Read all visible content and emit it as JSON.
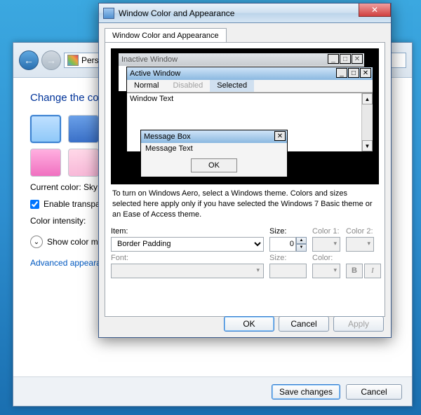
{
  "bg": {
    "addr_text": "Pers",
    "heading": "Change the color",
    "current_color_label": "Current color:",
    "current_color_value": "Sky",
    "transparency_label": "Enable transparenc",
    "intensity_label": "Color intensity:",
    "mixer_label": "Show color mixer",
    "adv_link": "Advanced appearance",
    "save": "Save changes",
    "cancel": "Cancel"
  },
  "dlg": {
    "title": "Window Color and Appearance",
    "tab": "Window Color and Appearance",
    "preview": {
      "inactive_title": "Inactive Window",
      "active_title": "Active Window",
      "menu_normal": "Normal",
      "menu_disabled": "Disabled",
      "menu_selected": "Selected",
      "window_text": "Window Text",
      "msgbox_title": "Message Box",
      "msgbox_text": "Message Text",
      "msgbox_ok": "OK"
    },
    "hint": "To turn on Windows Aero, select a Windows theme.  Colors and sizes selected here apply only if you have selected the Windows 7 Basic theme or an Ease of Access theme.",
    "item_label": "Item:",
    "item_value": "Border Padding",
    "size_label": "Size:",
    "size_value": "0",
    "color1_label": "Color 1:",
    "color2_label": "Color 2:",
    "font_label": "Font:",
    "fsize_label": "Size:",
    "fcolor_label": "Color:",
    "bold": "B",
    "italic": "I",
    "ok": "OK",
    "cancel": "Cancel",
    "apply": "Apply"
  }
}
